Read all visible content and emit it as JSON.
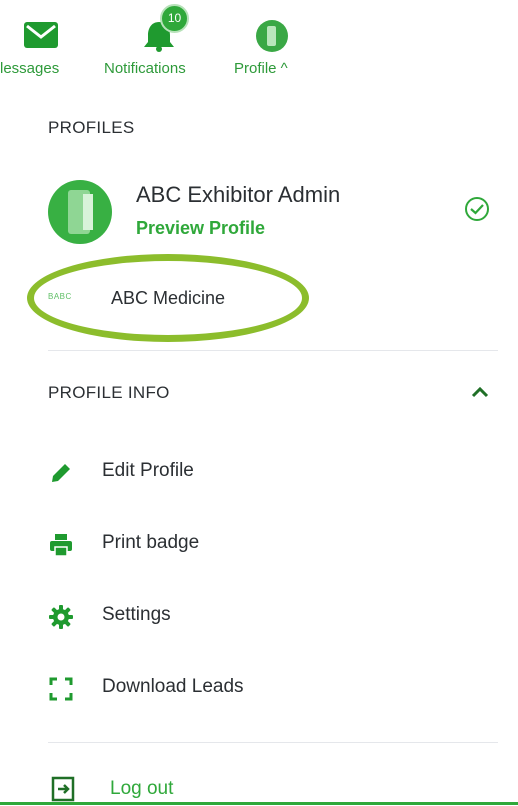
{
  "topnav": {
    "messages_label": "lessages",
    "notifications_label": "Notifications",
    "notifications_count": "10",
    "profile_label": "Profile ^"
  },
  "profiles": {
    "title": "PROFILES",
    "active": {
      "name": "ABC Exhibitor Admin",
      "link": "Preview Profile"
    },
    "other": {
      "logo_text": "BABC",
      "name": "ABC Medicine"
    }
  },
  "profile_info": {
    "title": "PROFILE INFO",
    "items": [
      {
        "label": "Edit Profile",
        "icon": "pencil-icon"
      },
      {
        "label": "Print badge",
        "icon": "printer-icon"
      },
      {
        "label": "Settings",
        "icon": "gear-icon"
      },
      {
        "label": "Download Leads",
        "icon": "scan-frame-icon"
      }
    ]
  },
  "logout": {
    "label": "Log out",
    "icon": "logout-icon"
  },
  "colors": {
    "accent": "#2fa83a",
    "highlight": "#8cbd2c",
    "text": "#2b2f33"
  }
}
